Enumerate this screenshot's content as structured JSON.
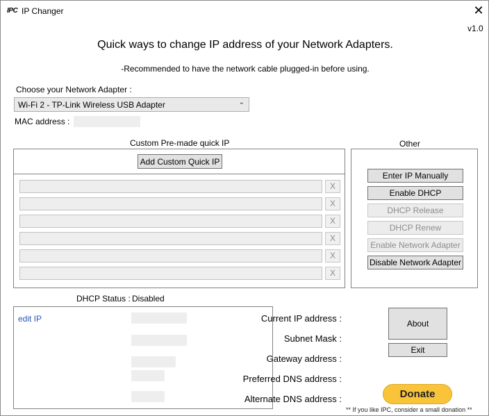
{
  "titlebar": {
    "logo": "IPC",
    "title": "IP Changer",
    "close_icon": "close-icon"
  },
  "version": "v1.0",
  "header": {
    "title": "Quick ways to change IP address of your Network Adapters.",
    "subtitle": "-Recommended to have the network cable plugged-in before using."
  },
  "adapter": {
    "label": "Choose your Network Adapter :",
    "selected": "Wi-Fi 2 - TP-Link Wireless USB Adapter",
    "mac_label": "MAC address :"
  },
  "custom_quick_ip": {
    "title": "Custom Pre-made quick IP",
    "add_button": "Add Custom Quick IP",
    "remove_label": "X",
    "slots": [
      "",
      "",
      "",
      "",
      "",
      ""
    ]
  },
  "other": {
    "title": "Other",
    "buttons": [
      {
        "label": "Enter IP Manually",
        "enabled": true
      },
      {
        "label": "Enable DHCP",
        "enabled": true
      },
      {
        "label": "DHCP Release",
        "enabled": false
      },
      {
        "label": "DHCP Renew",
        "enabled": false
      },
      {
        "label": "Enable Network Adapter",
        "enabled": false
      },
      {
        "label": "Disable Network Adapter",
        "enabled": true
      }
    ]
  },
  "dhcp_status": {
    "label": "DHCP Status :",
    "value": "Disabled"
  },
  "info": {
    "edit_link": "edit IP",
    "current_ip_label": "Current IP address :",
    "subnet_label": "Subnet Mask :",
    "gateway_label": "Gateway address :",
    "preferred_dns_label": "Preferred DNS address :",
    "alternate_dns_label": "Alternate DNS address :"
  },
  "about_button": "About",
  "exit_button": "Exit",
  "donate": {
    "label": "Donate",
    "note": "** If you like IPC, consider a small donation **",
    "color": "#f9c43a"
  }
}
